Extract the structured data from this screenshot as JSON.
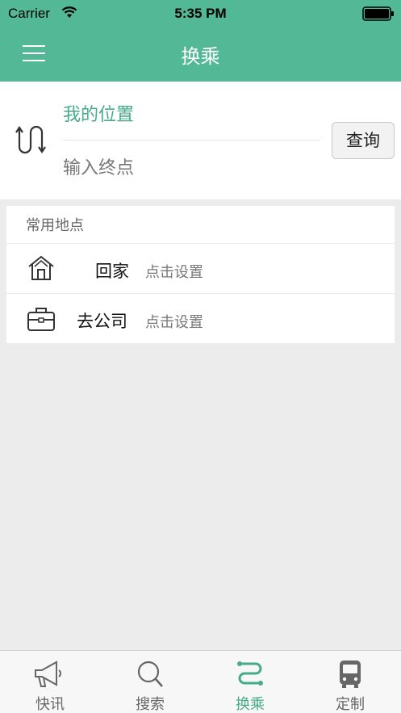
{
  "status_bar": {
    "carrier": "Carrier",
    "time": "5:35 PM"
  },
  "nav": {
    "title": "换乘",
    "menu_icon": "hamburger-menu-icon"
  },
  "route": {
    "start_value": "我的位置",
    "end_placeholder": "输入终点",
    "query_label": "查询",
    "swap_icon": "swap-route-icon"
  },
  "places": {
    "header": "常用地点",
    "items": [
      {
        "name": "回家",
        "hint": "点击设置",
        "icon": "home-icon"
      },
      {
        "name": "去公司",
        "hint": "点击设置",
        "icon": "briefcase-icon"
      }
    ]
  },
  "tabs": [
    {
      "label": "快讯",
      "icon": "megaphone-icon",
      "active": false
    },
    {
      "label": "搜索",
      "icon": "search-icon",
      "active": false
    },
    {
      "label": "换乘",
      "icon": "transfer-route-icon",
      "active": true
    },
    {
      "label": "定制",
      "icon": "bus-icon",
      "active": false
    }
  ],
  "colors": {
    "accent": "#52b896",
    "accent_text": "#45ab8a",
    "background": "#ececec"
  }
}
